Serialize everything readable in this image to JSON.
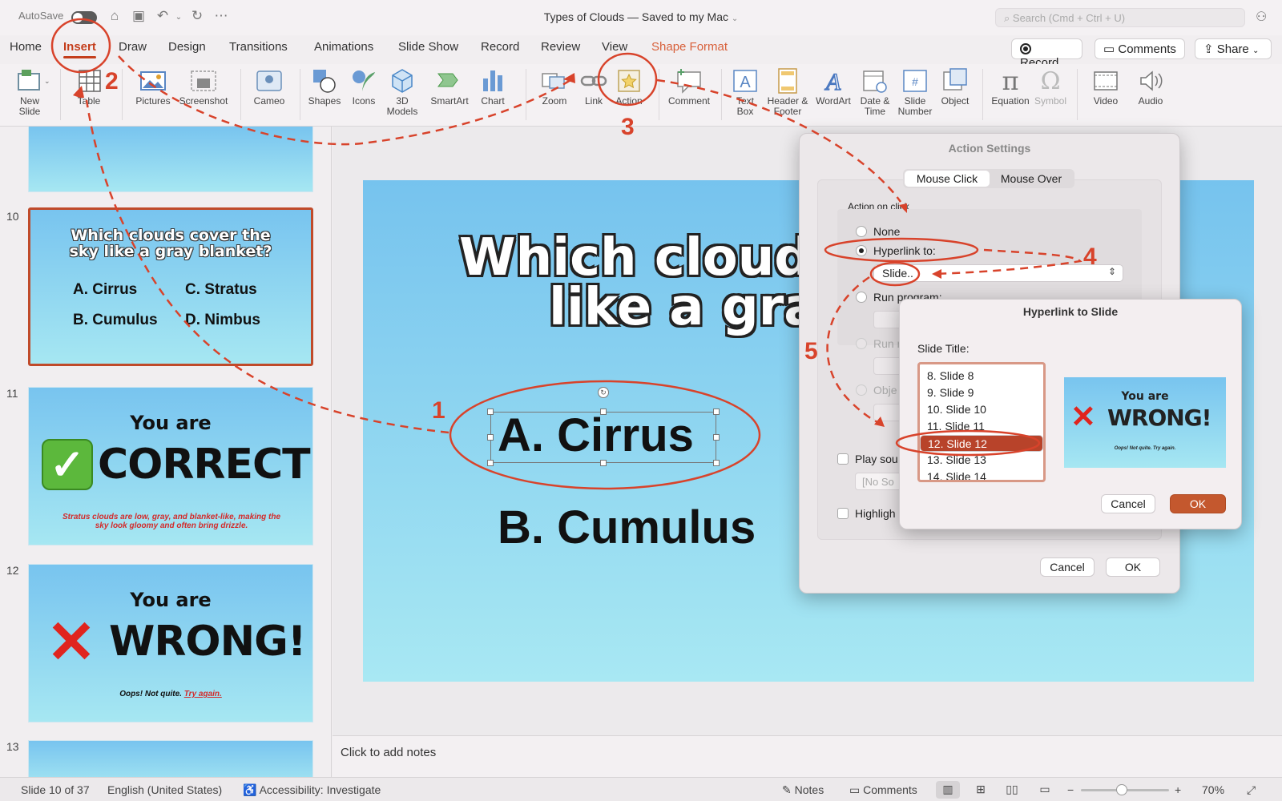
{
  "titlebar": {
    "autosave_label": "AutoSave",
    "doc_title": "Types of Clouds — Saved to my Mac",
    "search_placeholder": "Search (Cmd + Ctrl + U)"
  },
  "tabs": [
    {
      "label": "Home"
    },
    {
      "label": "Insert"
    },
    {
      "label": "Draw"
    },
    {
      "label": "Design"
    },
    {
      "label": "Transitions"
    },
    {
      "label": "Animations"
    },
    {
      "label": "Slide Show"
    },
    {
      "label": "Record"
    },
    {
      "label": "Review"
    },
    {
      "label": "View"
    },
    {
      "label": "Shape Format"
    }
  ],
  "tab_buttons": {
    "record": "Record",
    "comments": "Comments",
    "share": "Share"
  },
  "ribbon": {
    "new_slide": "New Slide",
    "table": "Table",
    "pictures": "Pictures",
    "screenshot": "Screenshot",
    "cameo": "Cameo",
    "shapes": "Shapes",
    "icons": "Icons",
    "models_3d": "3D Models",
    "smartart": "SmartArt",
    "chart": "Chart",
    "zoom": "Zoom",
    "link": "Link",
    "action": "Action",
    "comment": "Comment",
    "text_box": "Text Box",
    "header_footer": "Header & Footer",
    "wordart": "WordArt",
    "date_time": "Date & Time",
    "slide_number": "Slide Number",
    "object": "Object",
    "equation": "Equation",
    "symbol": "Symbol",
    "video": "Video",
    "audio": "Audio"
  },
  "thumbnails": {
    "n10": "10",
    "n11": "11",
    "n12": "12",
    "n13": "13",
    "slide10": {
      "title": "Which clouds cover the sky like a gray blanket?",
      "a": "A. Cirrus",
      "b": "B. Cumulus",
      "c": "C. Stratus",
      "d": "D. Nimbus"
    },
    "slide11": {
      "you_are": "You are",
      "word": "CORRECT!",
      "note": "Stratus clouds are low, gray, and blanket-like, making the sky look gloomy and often bring drizzle."
    },
    "slide12": {
      "you_are": "You are",
      "word": "WRONG!",
      "note_a": "Oops! Not quite.",
      "note_b": "Try again."
    }
  },
  "main_slide": {
    "title_line1": "Which clouds",
    "title_line2": "like a gray",
    "opt_a": "A. Cirrus",
    "opt_b": "B. Cumulus"
  },
  "notes_placeholder": "Click to add notes",
  "action_settings": {
    "title": "Action Settings",
    "tab_click": "Mouse Click",
    "tab_over": "Mouse Over",
    "group_label": "Action on click",
    "none": "None",
    "hyperlink": "Hyperlink to:",
    "hyperlink_value": "Slide..",
    "run_program": "Run program:",
    "run_macro": "Run m",
    "object_action": "Obje",
    "play_sound": "Play sou",
    "no_sound": "[No So",
    "highlight": "Highligh",
    "cancel": "Cancel",
    "ok": "OK"
  },
  "hyperlink_dialog": {
    "title": "Hyperlink to Slide",
    "slide_title_label": "Slide Title:",
    "items": [
      "8. Slide 8",
      "9. Slide 9",
      "10. Slide 10",
      "11. Slide 11",
      "12. Slide 12",
      "13. Slide 13",
      "14. Slide 14"
    ],
    "selected_index": 4,
    "preview_you_are": "You are",
    "preview_word": "WRONG!",
    "preview_note": "Oops! Not quite. Try again.",
    "cancel": "Cancel",
    "ok": "OK"
  },
  "status": {
    "slide_pos": "Slide 10 of 37",
    "language": "English (United States)",
    "accessibility": "Accessibility: Investigate",
    "notes": "Notes",
    "comments": "Comments",
    "zoom": "70%"
  },
  "annotations": [
    "1",
    "2",
    "3",
    "4",
    "5"
  ],
  "colors": {
    "accent": "#c43e1c",
    "annotation": "#d8432b",
    "slide_top": "#76c3ee",
    "slide_bottom": "#a8e8f3"
  }
}
